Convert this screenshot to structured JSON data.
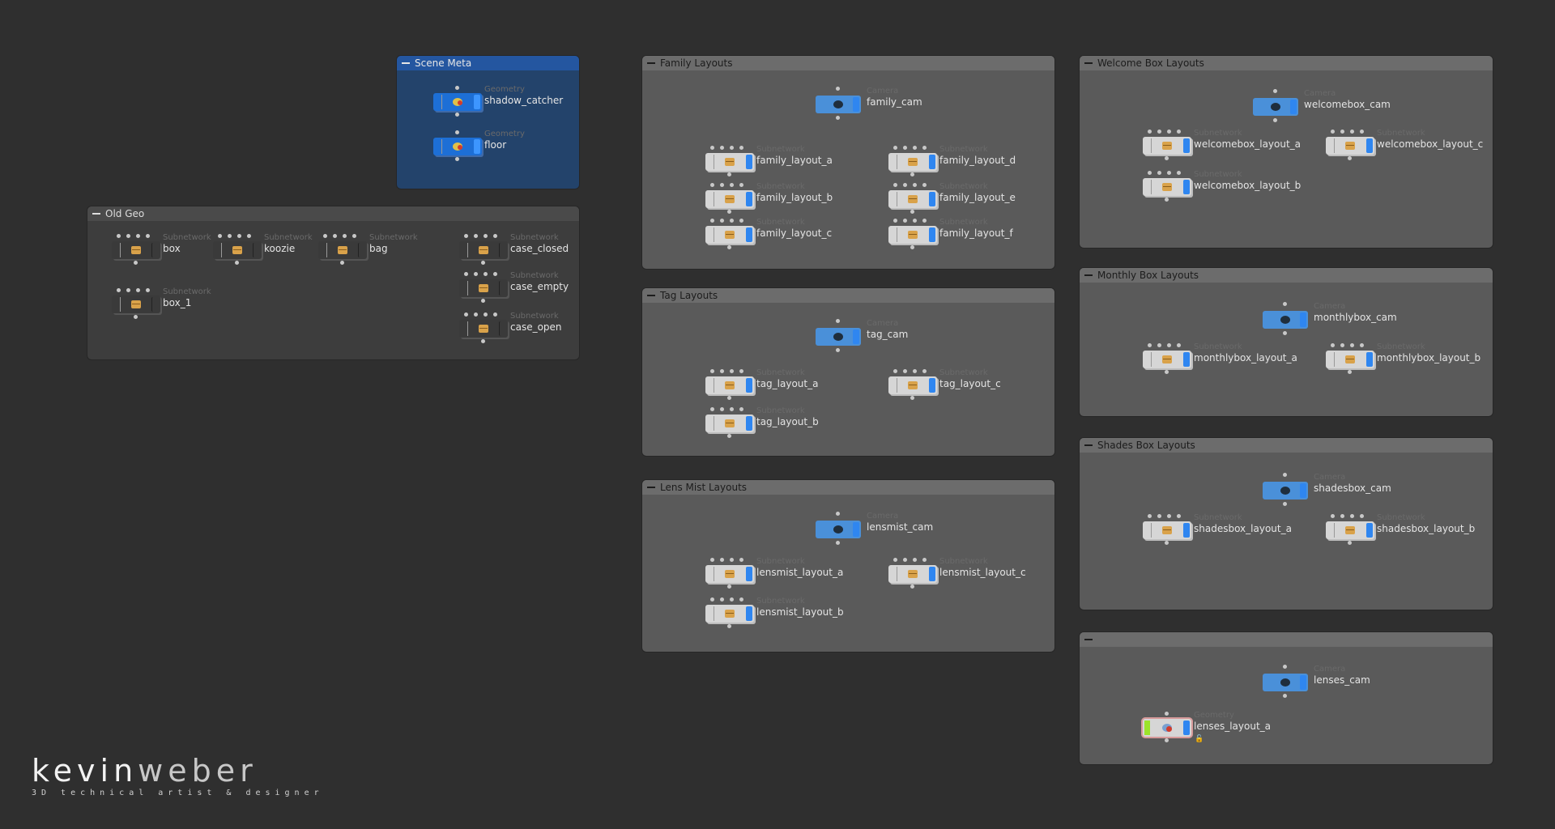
{
  "boxes": [
    {
      "title": "Scene Meta",
      "nodes": [
        {
          "type": "Geometry",
          "name": "shadow_catcher"
        },
        {
          "type": "Geometry",
          "name": "floor"
        }
      ]
    },
    {
      "title": "Old Geo",
      "nodes": [
        {
          "type": "Subnetwork",
          "name": "box"
        },
        {
          "type": "Subnetwork",
          "name": "koozie"
        },
        {
          "type": "Subnetwork",
          "name": "bag"
        },
        {
          "type": "Subnetwork",
          "name": "case_closed"
        },
        {
          "type": "Subnetwork",
          "name": "case_empty"
        },
        {
          "type": "Subnetwork",
          "name": "case_open"
        },
        {
          "type": "Subnetwork",
          "name": "box_1"
        }
      ]
    },
    {
      "title": "Family Layouts",
      "nodes": [
        {
          "type": "Camera",
          "name": "family_cam"
        },
        {
          "type": "Subnetwork",
          "name": "family_layout_a"
        },
        {
          "type": "Subnetwork",
          "name": "family_layout_b"
        },
        {
          "type": "Subnetwork",
          "name": "family_layout_c"
        },
        {
          "type": "Subnetwork",
          "name": "family_layout_d"
        },
        {
          "type": "Subnetwork",
          "name": "family_layout_e"
        },
        {
          "type": "Subnetwork",
          "name": "family_layout_f"
        }
      ]
    },
    {
      "title": "Tag Layouts",
      "nodes": [
        {
          "type": "Camera",
          "name": "tag_cam"
        },
        {
          "type": "Subnetwork",
          "name": "tag_layout_a"
        },
        {
          "type": "Subnetwork",
          "name": "tag_layout_c"
        },
        {
          "type": "Subnetwork",
          "name": "tag_layout_b"
        }
      ]
    },
    {
      "title": "Lens Mist Layouts",
      "nodes": [
        {
          "type": "Camera",
          "name": "lensmist_cam"
        },
        {
          "type": "Subnetwork",
          "name": "lensmist_layout_a"
        },
        {
          "type": "Subnetwork",
          "name": "lensmist_layout_c"
        },
        {
          "type": "Subnetwork",
          "name": "lensmist_layout_b"
        }
      ]
    },
    {
      "title": "Welcome Box Layouts",
      "nodes": [
        {
          "type": "Camera",
          "name": "welcomebox_cam"
        },
        {
          "type": "Subnetwork",
          "name": "welcomebox_layout_a"
        },
        {
          "type": "Subnetwork",
          "name": "welcomebox_layout_c"
        },
        {
          "type": "Subnetwork",
          "name": "welcomebox_layout_b"
        }
      ]
    },
    {
      "title": "Monthly Box Layouts",
      "nodes": [
        {
          "type": "Camera",
          "name": "monthlybox_cam"
        },
        {
          "type": "Subnetwork",
          "name": "monthlybox_layout_a"
        },
        {
          "type": "Subnetwork",
          "name": "monthlybox_layout_b"
        }
      ]
    },
    {
      "title": "Shades Box Layouts",
      "nodes": [
        {
          "type": "Camera",
          "name": "shadesbox_cam"
        },
        {
          "type": "Subnetwork",
          "name": "shadesbox_layout_a"
        },
        {
          "type": "Subnetwork",
          "name": "shadesbox_layout_b"
        }
      ]
    },
    {
      "title": "",
      "nodes": [
        {
          "type": "Camera",
          "name": "lenses_cam"
        },
        {
          "type": "Geometry",
          "name": "lenses_layout_a"
        }
      ]
    }
  ],
  "logo": {
    "first": "kevin",
    "last": "weber",
    "tagline": "3D technical artist & designer"
  }
}
